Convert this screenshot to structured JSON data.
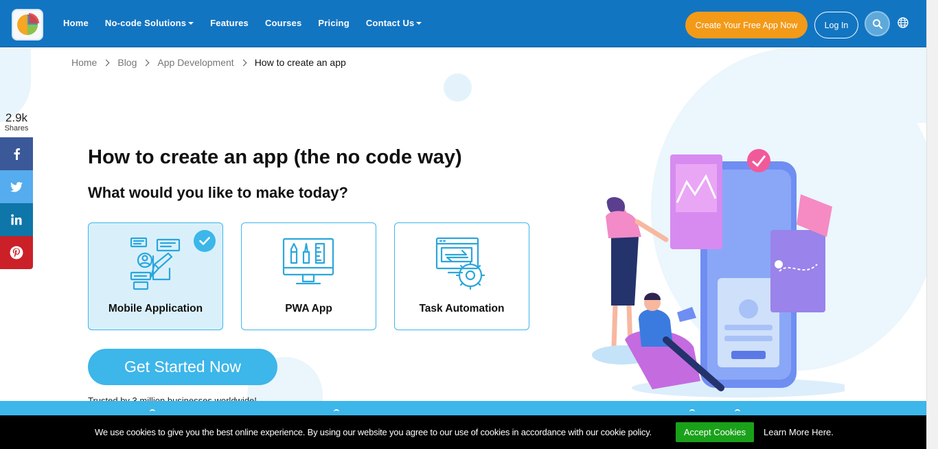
{
  "header": {
    "logo_name": "pie-chart-logo",
    "nav": [
      {
        "label": "Home",
        "dropdown": false
      },
      {
        "label": "No-code Solutions",
        "dropdown": true
      },
      {
        "label": "Features",
        "dropdown": false
      },
      {
        "label": "Courses",
        "dropdown": false
      },
      {
        "label": "Pricing",
        "dropdown": false
      },
      {
        "label": "Contact Us",
        "dropdown": true
      }
    ],
    "cta": "Create Your Free App Now",
    "login": "Log In"
  },
  "breadcrumb": {
    "items": [
      "Home",
      "Blog",
      "App Development"
    ],
    "current": "How to create an app"
  },
  "shares": {
    "count": "2.9k",
    "label": "Shares",
    "networks": [
      "facebook",
      "twitter",
      "linkedin",
      "pinterest"
    ]
  },
  "hero": {
    "title": "How to create an app (the no code way)",
    "subtitle": "What would you like to make today?",
    "options": [
      {
        "label": "Mobile Application",
        "selected": true,
        "icon": "mobile-app-icon"
      },
      {
        "label": "PWA App",
        "selected": false,
        "icon": "pwa-design-icon"
      },
      {
        "label": "Task Automation",
        "selected": false,
        "icon": "automation-gear-icon"
      }
    ],
    "button": "Get Started Now",
    "trusted": "Trusted by 3 million businesses worldwide!"
  },
  "cookie": {
    "text": "We use cookies to give you the best online experience. By using our website you agree to our use of cookies in accordance with our cookie policy.",
    "accept": "Accept Cookies",
    "more": "Learn More Here."
  },
  "colors": {
    "header": "#1275c2",
    "accent": "#3db6ea",
    "cta": "#f39a18",
    "accept": "#1aa11a"
  }
}
